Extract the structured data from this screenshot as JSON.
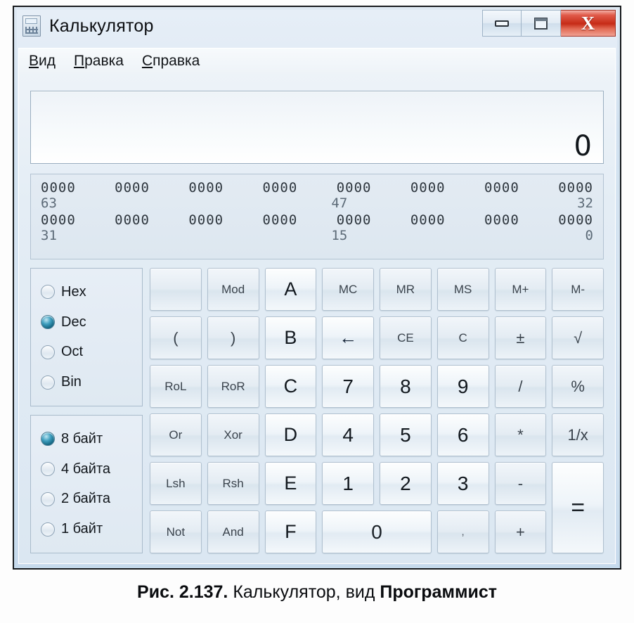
{
  "window": {
    "title": "Калькулятор",
    "icon": "calculator-icon",
    "controls": {
      "minimize": "—",
      "maximize": "▫",
      "close": "X"
    }
  },
  "menu": [
    {
      "mnemonic": "В",
      "rest": "ид"
    },
    {
      "mnemonic": "П",
      "rest": "равка"
    },
    {
      "mnemonic": "С",
      "rest": "правка"
    }
  ],
  "display": {
    "value": "0"
  },
  "bits": {
    "row1": [
      "0000",
      "0000",
      "0000",
      "0000",
      "0000",
      "0000",
      "0000",
      "0000"
    ],
    "row1_labels": {
      "left": "63",
      "mid": "47",
      "right": "32"
    },
    "row2": [
      "0000",
      "0000",
      "0000",
      "0000",
      "0000",
      "0000",
      "0000",
      "0000"
    ],
    "row2_labels": {
      "left": "31",
      "mid": "15",
      "right": "0"
    }
  },
  "number_system": {
    "selected": "Dec",
    "options": [
      {
        "label": "Hex",
        "checked": false
      },
      {
        "label": "Dec",
        "checked": true
      },
      {
        "label": "Oct",
        "checked": false
      },
      {
        "label": "Bin",
        "checked": false
      }
    ]
  },
  "word_size": {
    "selected": "8 байт",
    "options": [
      {
        "label": "8 байт",
        "checked": true
      },
      {
        "label": "4 байта",
        "checked": false
      },
      {
        "label": "2 байта",
        "checked": false
      },
      {
        "label": "1 байт",
        "checked": false
      }
    ]
  },
  "keypad": {
    "keys": [
      {
        "label": "",
        "name": "key-blank",
        "style": "dim blank"
      },
      {
        "label": "Mod",
        "name": "key-mod",
        "style": "dim small"
      },
      {
        "label": "A",
        "name": "key-hex-a",
        "style": "hexletter"
      },
      {
        "label": "MC",
        "name": "key-memory-clear",
        "style": "dim small"
      },
      {
        "label": "MR",
        "name": "key-memory-recall",
        "style": "dim small"
      },
      {
        "label": "MS",
        "name": "key-memory-store",
        "style": "dim small"
      },
      {
        "label": "M+",
        "name": "key-memory-add",
        "style": "dim small"
      },
      {
        "label": "M-",
        "name": "key-memory-subtract",
        "style": "dim small"
      },
      {
        "label": "(",
        "name": "key-paren-open",
        "style": "dim op"
      },
      {
        "label": ")",
        "name": "key-paren-close",
        "style": "dim op"
      },
      {
        "label": "B",
        "name": "key-hex-b",
        "style": "hexletter"
      },
      {
        "label": "←",
        "name": "key-backspace",
        "style": "backspace"
      },
      {
        "label": "CE",
        "name": "key-clear-entry",
        "style": "dim small"
      },
      {
        "label": "C",
        "name": "key-clear",
        "style": "dim small"
      },
      {
        "label": "±",
        "name": "key-sign",
        "style": "dim op"
      },
      {
        "label": "√",
        "name": "key-sqrt",
        "style": "dim op"
      },
      {
        "label": "RoL",
        "name": "key-rotate-left",
        "style": "dim small"
      },
      {
        "label": "RoR",
        "name": "key-rotate-right",
        "style": "dim small"
      },
      {
        "label": "C",
        "name": "key-hex-c",
        "style": "hexletter"
      },
      {
        "label": "7",
        "name": "key-7",
        "style": "digit"
      },
      {
        "label": "8",
        "name": "key-8",
        "style": "digit"
      },
      {
        "label": "9",
        "name": "key-9",
        "style": "digit"
      },
      {
        "label": "/",
        "name": "key-divide",
        "style": "dim op"
      },
      {
        "label": "%",
        "name": "key-percent",
        "style": "dim op"
      },
      {
        "label": "Or",
        "name": "key-or",
        "style": "dim small"
      },
      {
        "label": "Xor",
        "name": "key-xor",
        "style": "dim small"
      },
      {
        "label": "D",
        "name": "key-hex-d",
        "style": "hexletter"
      },
      {
        "label": "4",
        "name": "key-4",
        "style": "digit"
      },
      {
        "label": "5",
        "name": "key-5",
        "style": "digit"
      },
      {
        "label": "6",
        "name": "key-6",
        "style": "digit"
      },
      {
        "label": "*",
        "name": "key-multiply",
        "style": "dim op"
      },
      {
        "label": "1/x",
        "name": "key-reciprocal",
        "style": "dim op"
      },
      {
        "label": "Lsh",
        "name": "key-left-shift",
        "style": "dim small"
      },
      {
        "label": "Rsh",
        "name": "key-right-shift",
        "style": "dim small"
      },
      {
        "label": "E",
        "name": "key-hex-e",
        "style": "hexletter"
      },
      {
        "label": "1",
        "name": "key-1",
        "style": "digit"
      },
      {
        "label": "2",
        "name": "key-2",
        "style": "digit"
      },
      {
        "label": "3",
        "name": "key-3",
        "style": "digit"
      },
      {
        "label": "-",
        "name": "key-subtract",
        "style": "dim op"
      },
      {
        "label": "=",
        "name": "key-equals",
        "style": "eq"
      },
      {
        "label": "Not",
        "name": "key-not",
        "style": "dim small"
      },
      {
        "label": "And",
        "name": "key-and",
        "style": "dim small"
      },
      {
        "label": "F",
        "name": "key-hex-f",
        "style": "hexletter"
      },
      {
        "label": "0",
        "name": "key-0",
        "style": "wide0"
      },
      {
        "label": ",",
        "name": "key-decimal-separator",
        "style": "dim tiny"
      },
      {
        "label": "+",
        "name": "key-add",
        "style": "dim op"
      }
    ]
  },
  "caption": {
    "figure": "Рис. 2.137.",
    "text": " Калькулятор, вид ",
    "bold_tail": "Программист"
  }
}
